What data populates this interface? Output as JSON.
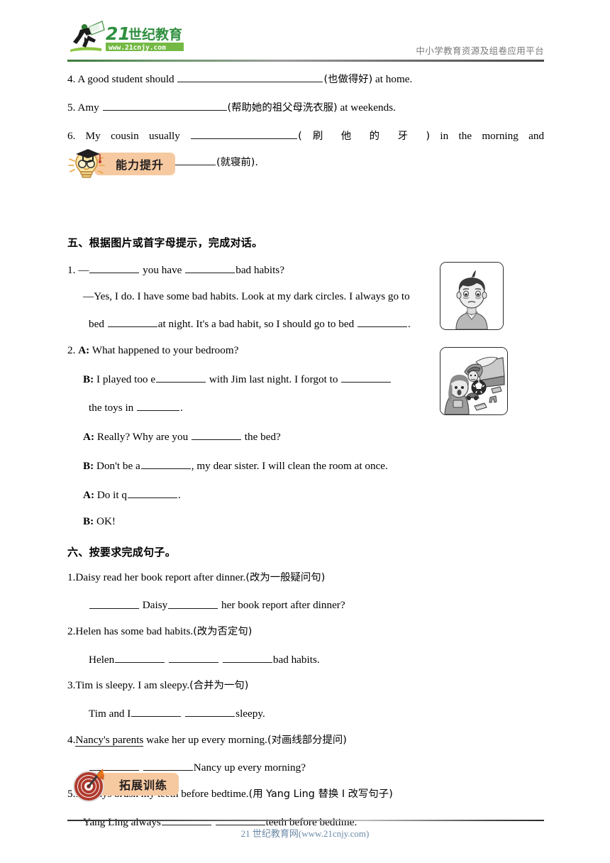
{
  "header": {
    "logo_title": "21世纪教育",
    "logo_url": "www.21cnjy.com",
    "right_text": "中小学教育资源及组卷应用平台"
  },
  "translation_questions": [
    {
      "num": "4.",
      "pre": "A good student should",
      "hint": "(也做得好)",
      "post": "at home."
    },
    {
      "num": "5.",
      "pre": "Amy",
      "hint": "(帮助她的祖父母洗衣服)",
      "post": "at weekends."
    },
    {
      "num": "6.",
      "pre_words": [
        "My",
        "cousin",
        "usually"
      ],
      "hint": "( 刷 他 的 牙 )",
      "post_words": [
        "in",
        "the",
        "morning",
        "and"
      ],
      "tail_hint": "(就寝前)."
    }
  ],
  "badges": {
    "ability": {
      "label": "能力提升",
      "icon": "lightbulb-graduate-icon",
      "pill_color": "#f6c9a0"
    },
    "expand": {
      "label": "拓展训练",
      "icon": "dartboard-arrow-icon",
      "pill_color": "#f6c9a0"
    }
  },
  "section_five": {
    "heading": "五、根据图片或首字母提示，完成对话。",
    "items": [
      {
        "num": "1.",
        "lines": [
          {
            "parts": [
              "—",
              "BLANK_MD",
              " you have ",
              "BLANK_MD",
              "bad habits?"
            ]
          },
          {
            "parts": [
              "—Yes, I do. I have some bad habits. Look at my dark circles. I always go to"
            ]
          },
          {
            "parts": [
              "bed ",
              "BLANK_MD",
              "at night. It's a bad habit, so I should go to bed ",
              "BLANK_MD",
              "."
            ]
          }
        ]
      },
      {
        "num": "2.",
        "lines": [
          {
            "speaker": "A:",
            "text": "What happened to your bedroom?"
          },
          {
            "speaker": "B:",
            "text": "I played too e______ with Jim last night. I forgot to ______"
          },
          {
            "speaker": "",
            "text": "the toys in ______."
          },
          {
            "speaker": "A:",
            "text": "Really? Why are you ______ the bed?"
          },
          {
            "speaker": "B:",
            "text": "Don't be a______, my dear sister. I will clean the room at once."
          },
          {
            "speaker": "A:",
            "text": "Do it q______."
          },
          {
            "speaker": "B:",
            "text": "OK!"
          }
        ]
      }
    ],
    "pictures": [
      {
        "name": "boy-with-dark-circles",
        "alt": "cartoon boy looking tired with dark circles"
      },
      {
        "name": "messy-bedroom-toys",
        "alt": "messy bedroom with toys scattered on floor"
      }
    ]
  },
  "section_six": {
    "heading": "六、按要求完成句子。",
    "items": [
      {
        "num": "1.",
        "prompt": "Daisy read her book report after dinner.",
        "instruction": "(改为一般疑问句)",
        "answer_pre": "",
        "answer_mid": "Daisy",
        "answer_post": "her book report after dinner?"
      },
      {
        "num": "2.",
        "prompt": "Helen has some bad habits.",
        "instruction": "(改为否定句)",
        "answer_pre": "Helen",
        "answer_post": "bad habits."
      },
      {
        "num": "3.",
        "prompt": "Tim is sleepy. I am sleepy.",
        "instruction": "(合并为一句)",
        "answer_pre": "Tim and I",
        "answer_post": "sleepy."
      },
      {
        "num": "4.",
        "prompt_underlined": "Nancy's parents",
        "prompt_rest": " wake her up every morning.",
        "instruction": "(对画线部分提问)",
        "answer_post": "Nancy up every morning?"
      },
      {
        "num": "5.",
        "prompt": "I always brush my teeth before bedtime.",
        "instruction": "(用 Yang Ling 替换 I 改写句子)",
        "answer_pre": "Yang Ling always",
        "answer_post": "teeth before bedtime."
      }
    ]
  },
  "footer": {
    "text": "21 世纪教育网(www.21cnjy.com)",
    "color": "#6b8aa8"
  }
}
